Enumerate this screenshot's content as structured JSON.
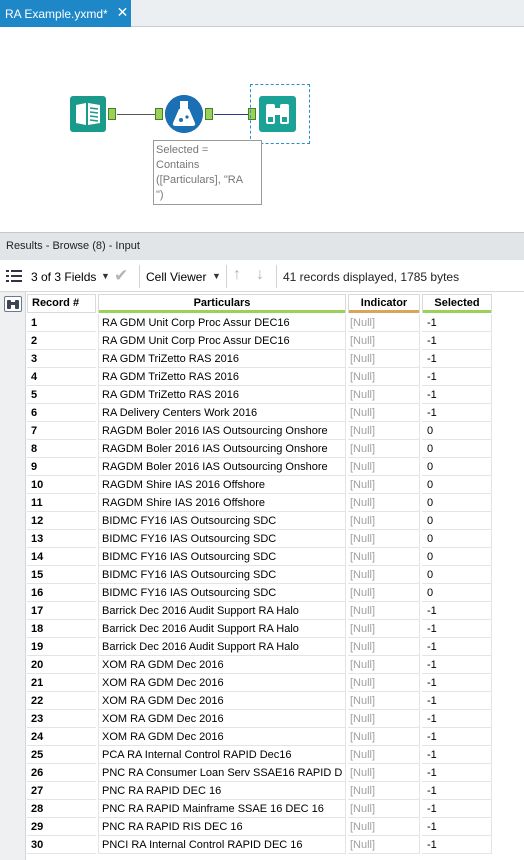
{
  "tab": {
    "title": "RA Example.yxmd*",
    "close_glyph": "✕"
  },
  "canvas": {
    "filter_annotation": [
      "Selected =",
      "Contains",
      "([Particulars], \"RA",
      "\")"
    ]
  },
  "results": {
    "title": "Results - Browse (8) - Input",
    "fields_label": "3 of 3 Fields",
    "viewer_label": "Cell Viewer",
    "status": "41 records displayed, 1785 bytes"
  },
  "colors": {
    "accent": "#1d87c8",
    "particulars_underline": "#9bd05b",
    "indicator_underline": "#d9a55a",
    "selected_underline": "#9bd05b"
  },
  "table": {
    "columns": [
      "Record #",
      "Particulars",
      "Indicator",
      "Selected"
    ],
    "rows": [
      [
        "1",
        "RA GDM Unit Corp Proc Assur  DEC16",
        "[Null]",
        "-1"
      ],
      [
        "2",
        "RA GDM Unit Corp Proc Assur  DEC16",
        "[Null]",
        "-1"
      ],
      [
        "3",
        "RA GDM TriZetto RAS 2016",
        "[Null]",
        "-1"
      ],
      [
        "4",
        "RA GDM TriZetto RAS 2016",
        "[Null]",
        "-1"
      ],
      [
        "5",
        "RA GDM TriZetto RAS 2016",
        "[Null]",
        "-1"
      ],
      [
        "6",
        "RA Delivery Centers Work 2016",
        "[Null]",
        "-1"
      ],
      [
        "7",
        "RAGDM Boler 2016 IAS Outsourcing Onshore",
        "[Null]",
        "0"
      ],
      [
        "8",
        "RAGDM Boler 2016 IAS Outsourcing Onshore",
        "[Null]",
        "0"
      ],
      [
        "9",
        "RAGDM Boler 2016 IAS Outsourcing Onshore",
        "[Null]",
        "0"
      ],
      [
        "10",
        "RAGDM Shire IAS 2016 Offshore",
        "[Null]",
        "0"
      ],
      [
        "11",
        "RAGDM Shire IAS 2016 Offshore",
        "[Null]",
        "0"
      ],
      [
        "12",
        "BIDMC FY16 IAS Outsourcing SDC",
        "[Null]",
        "0"
      ],
      [
        "13",
        "BIDMC FY16 IAS Outsourcing SDC",
        "[Null]",
        "0"
      ],
      [
        "14",
        "BIDMC FY16 IAS Outsourcing SDC",
        "[Null]",
        "0"
      ],
      [
        "15",
        "BIDMC FY16 IAS Outsourcing SDC",
        "[Null]",
        "0"
      ],
      [
        "16",
        "BIDMC FY16 IAS Outsourcing SDC",
        "[Null]",
        "0"
      ],
      [
        "17",
        "Barrick Dec 2016 Audit Support RA Halo",
        "[Null]",
        "-1"
      ],
      [
        "18",
        "Barrick Dec 2016 Audit Support RA Halo",
        "[Null]",
        "-1"
      ],
      [
        "19",
        "Barrick Dec 2016 Audit Support RA Halo",
        "[Null]",
        "-1"
      ],
      [
        "20",
        "XOM RA GDM Dec 2016",
        "[Null]",
        "-1"
      ],
      [
        "21",
        "XOM RA GDM Dec 2016",
        "[Null]",
        "-1"
      ],
      [
        "22",
        "XOM RA GDM Dec 2016",
        "[Null]",
        "-1"
      ],
      [
        "23",
        "XOM RA GDM Dec 2016",
        "[Null]",
        "-1"
      ],
      [
        "24",
        "XOM RA GDM Dec 2016",
        "[Null]",
        "-1"
      ],
      [
        "25",
        "PCA RA Internal Control RAPID Dec16",
        "[Null]",
        "-1"
      ],
      [
        "26",
        "PNC RA Consumer Loan Serv SSAE16 RAPID D",
        "[Null]",
        "-1"
      ],
      [
        "27",
        "PNC RA RAPID DEC 16",
        "[Null]",
        "-1"
      ],
      [
        "28",
        "PNC RA RAPID Mainframe SSAE 16 DEC 16",
        "[Null]",
        "-1"
      ],
      [
        "29",
        "PNC RA RAPID RIS DEC 16",
        "[Null]",
        "-1"
      ],
      [
        "30",
        "PNCI RA Internal Control RAPID DEC 16",
        "[Null]",
        "-1"
      ]
    ]
  }
}
